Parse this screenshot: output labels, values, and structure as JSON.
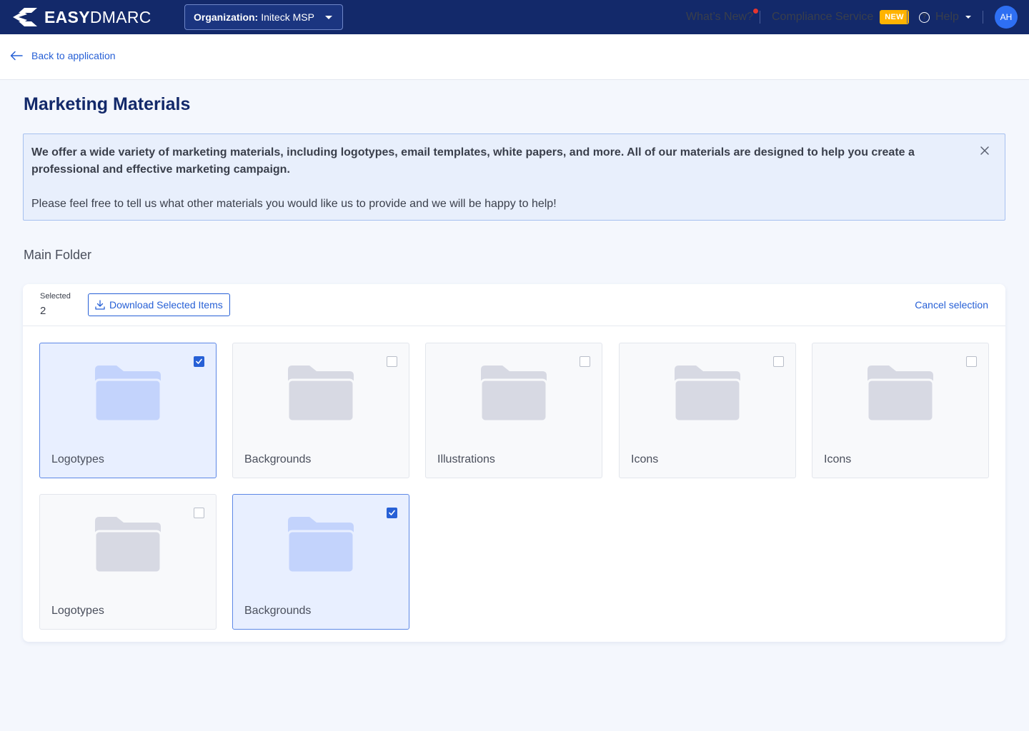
{
  "header": {
    "logo_bold": "EASY",
    "logo_light": "DMARC",
    "org_label": "Organization:",
    "org_value": "Initeck MSP",
    "whats_new": "What’s New?",
    "compliance": "Compliance Service",
    "compliance_badge": "NEW",
    "help": "Help",
    "avatar": "AH"
  },
  "back_link": "Back to application",
  "page_title": "Marketing Materials",
  "info": {
    "paragraph1": "We offer a wide variety of marketing materials, including logotypes, email templates, white papers, and more. All of our materials are designed to help you create a professional and effective marketing campaign.",
    "paragraph2": "Please feel free to tell us what other materials you would like us to provide and we will be happy to help!"
  },
  "folder_heading": "Main Folder",
  "selection": {
    "label": "Selected",
    "count": "2",
    "download_label": "Download Selected Items",
    "cancel_label": "Cancel selection"
  },
  "folders": [
    {
      "name": "Logotypes",
      "selected": true
    },
    {
      "name": "Backgrounds",
      "selected": false
    },
    {
      "name": "Illustrations",
      "selected": false
    },
    {
      "name": "Icons",
      "selected": false
    },
    {
      "name": "Icons",
      "selected": false
    },
    {
      "name": "Logotypes",
      "selected": false
    },
    {
      "name": "Backgrounds",
      "selected": true
    }
  ],
  "colors": {
    "navy": "#13296a",
    "accent": "#2760d6",
    "badge": "#ffb300",
    "folder_selected": "#c3d3fc",
    "folder_default": "#d7d9e3"
  }
}
